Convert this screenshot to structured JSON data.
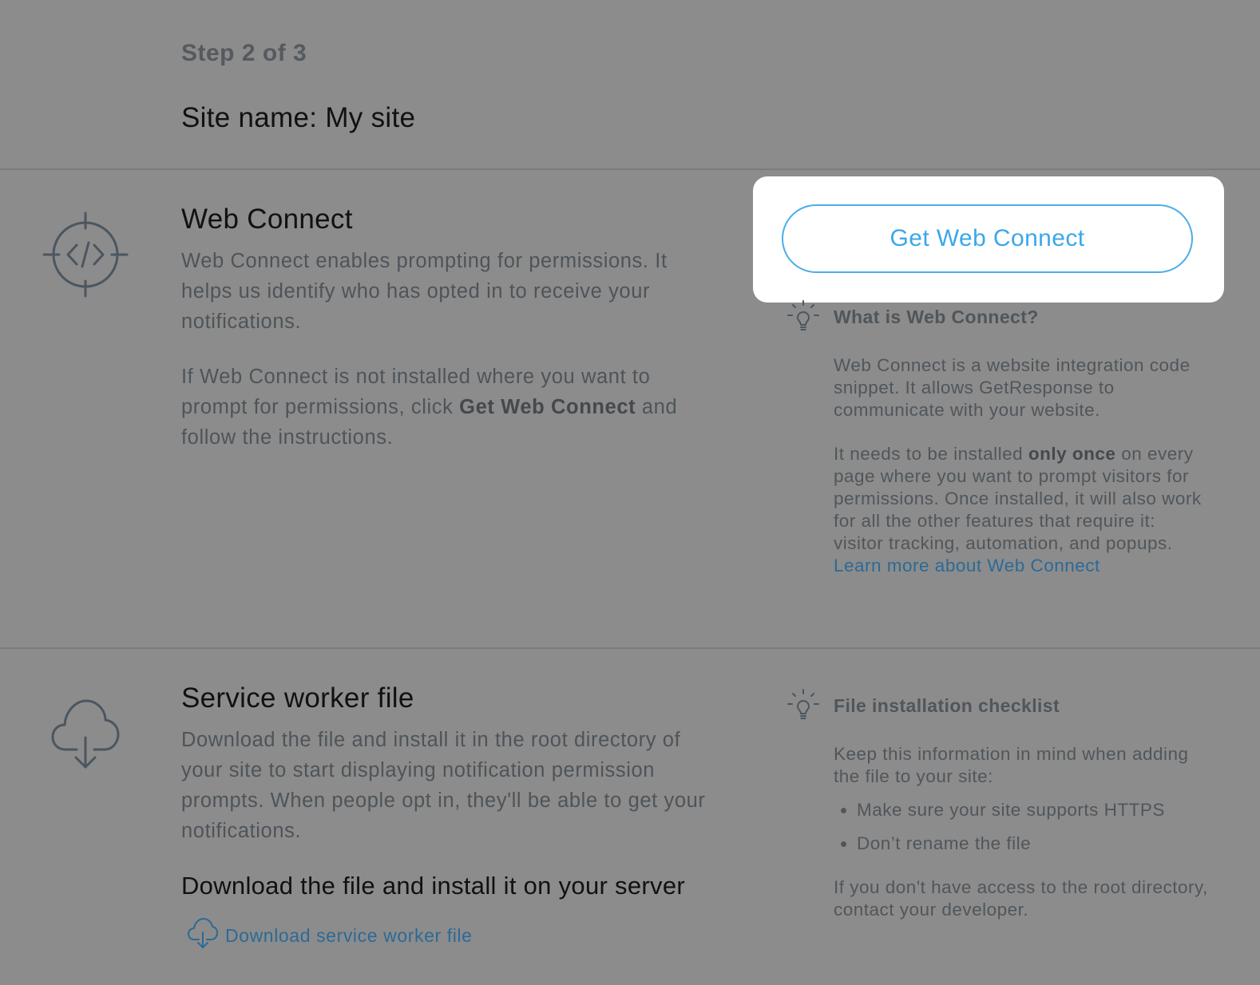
{
  "header": {
    "step": "Step 2 of 3",
    "site_name": "Site name: My site"
  },
  "web_connect": {
    "title": "Web Connect",
    "description": "Web Connect enables prompting for permissions. It helps us identify who has opted in to receive your notifications.",
    "instructions_before": "If Web Connect is not installed where you want to prompt for permissions, click ",
    "instructions_bold": "Get Web Connect",
    "instructions_after": " and follow the instructions.",
    "button_label": "Get Web Connect",
    "tip": {
      "title": "What is Web Connect?",
      "paragraph1": "Web Connect is a website integration code snippet. It allows GetResponse to communicate with your website.",
      "paragraph2_before": "It needs to be installed ",
      "paragraph2_bold": "only once",
      "paragraph2_after": " on every page where you want to prompt visitors for permissions. Once installed, it will also work for all the other features that require it: visitor tracking, automation, and popups.",
      "link": "Learn more about Web Connect"
    }
  },
  "service_worker": {
    "title": "Service worker file",
    "description": "Download the file and install it in the root directory of your site to start displaying notification permission prompts. When people opt in, they'll be able to get your notifications.",
    "subheading": "Download the file and install it on your server",
    "download_link": "Download service worker file",
    "tip": {
      "title": "File installation checklist",
      "intro": "Keep this information in mind when adding the file to your site:",
      "items": [
        "Make sure your site supports HTTPS",
        "Don’t rename the file"
      ],
      "outro": "If you don't have access to the root directory, contact your developer."
    }
  },
  "icons": {
    "web_connect": "target-code-icon",
    "service_worker": "cloud-download-icon",
    "tip": "lightbulb-icon",
    "download": "cloud-download-icon"
  },
  "colors": {
    "overlay": "#8c8c8c",
    "accent": "#3ba7ea",
    "link": "#2c6a96"
  }
}
